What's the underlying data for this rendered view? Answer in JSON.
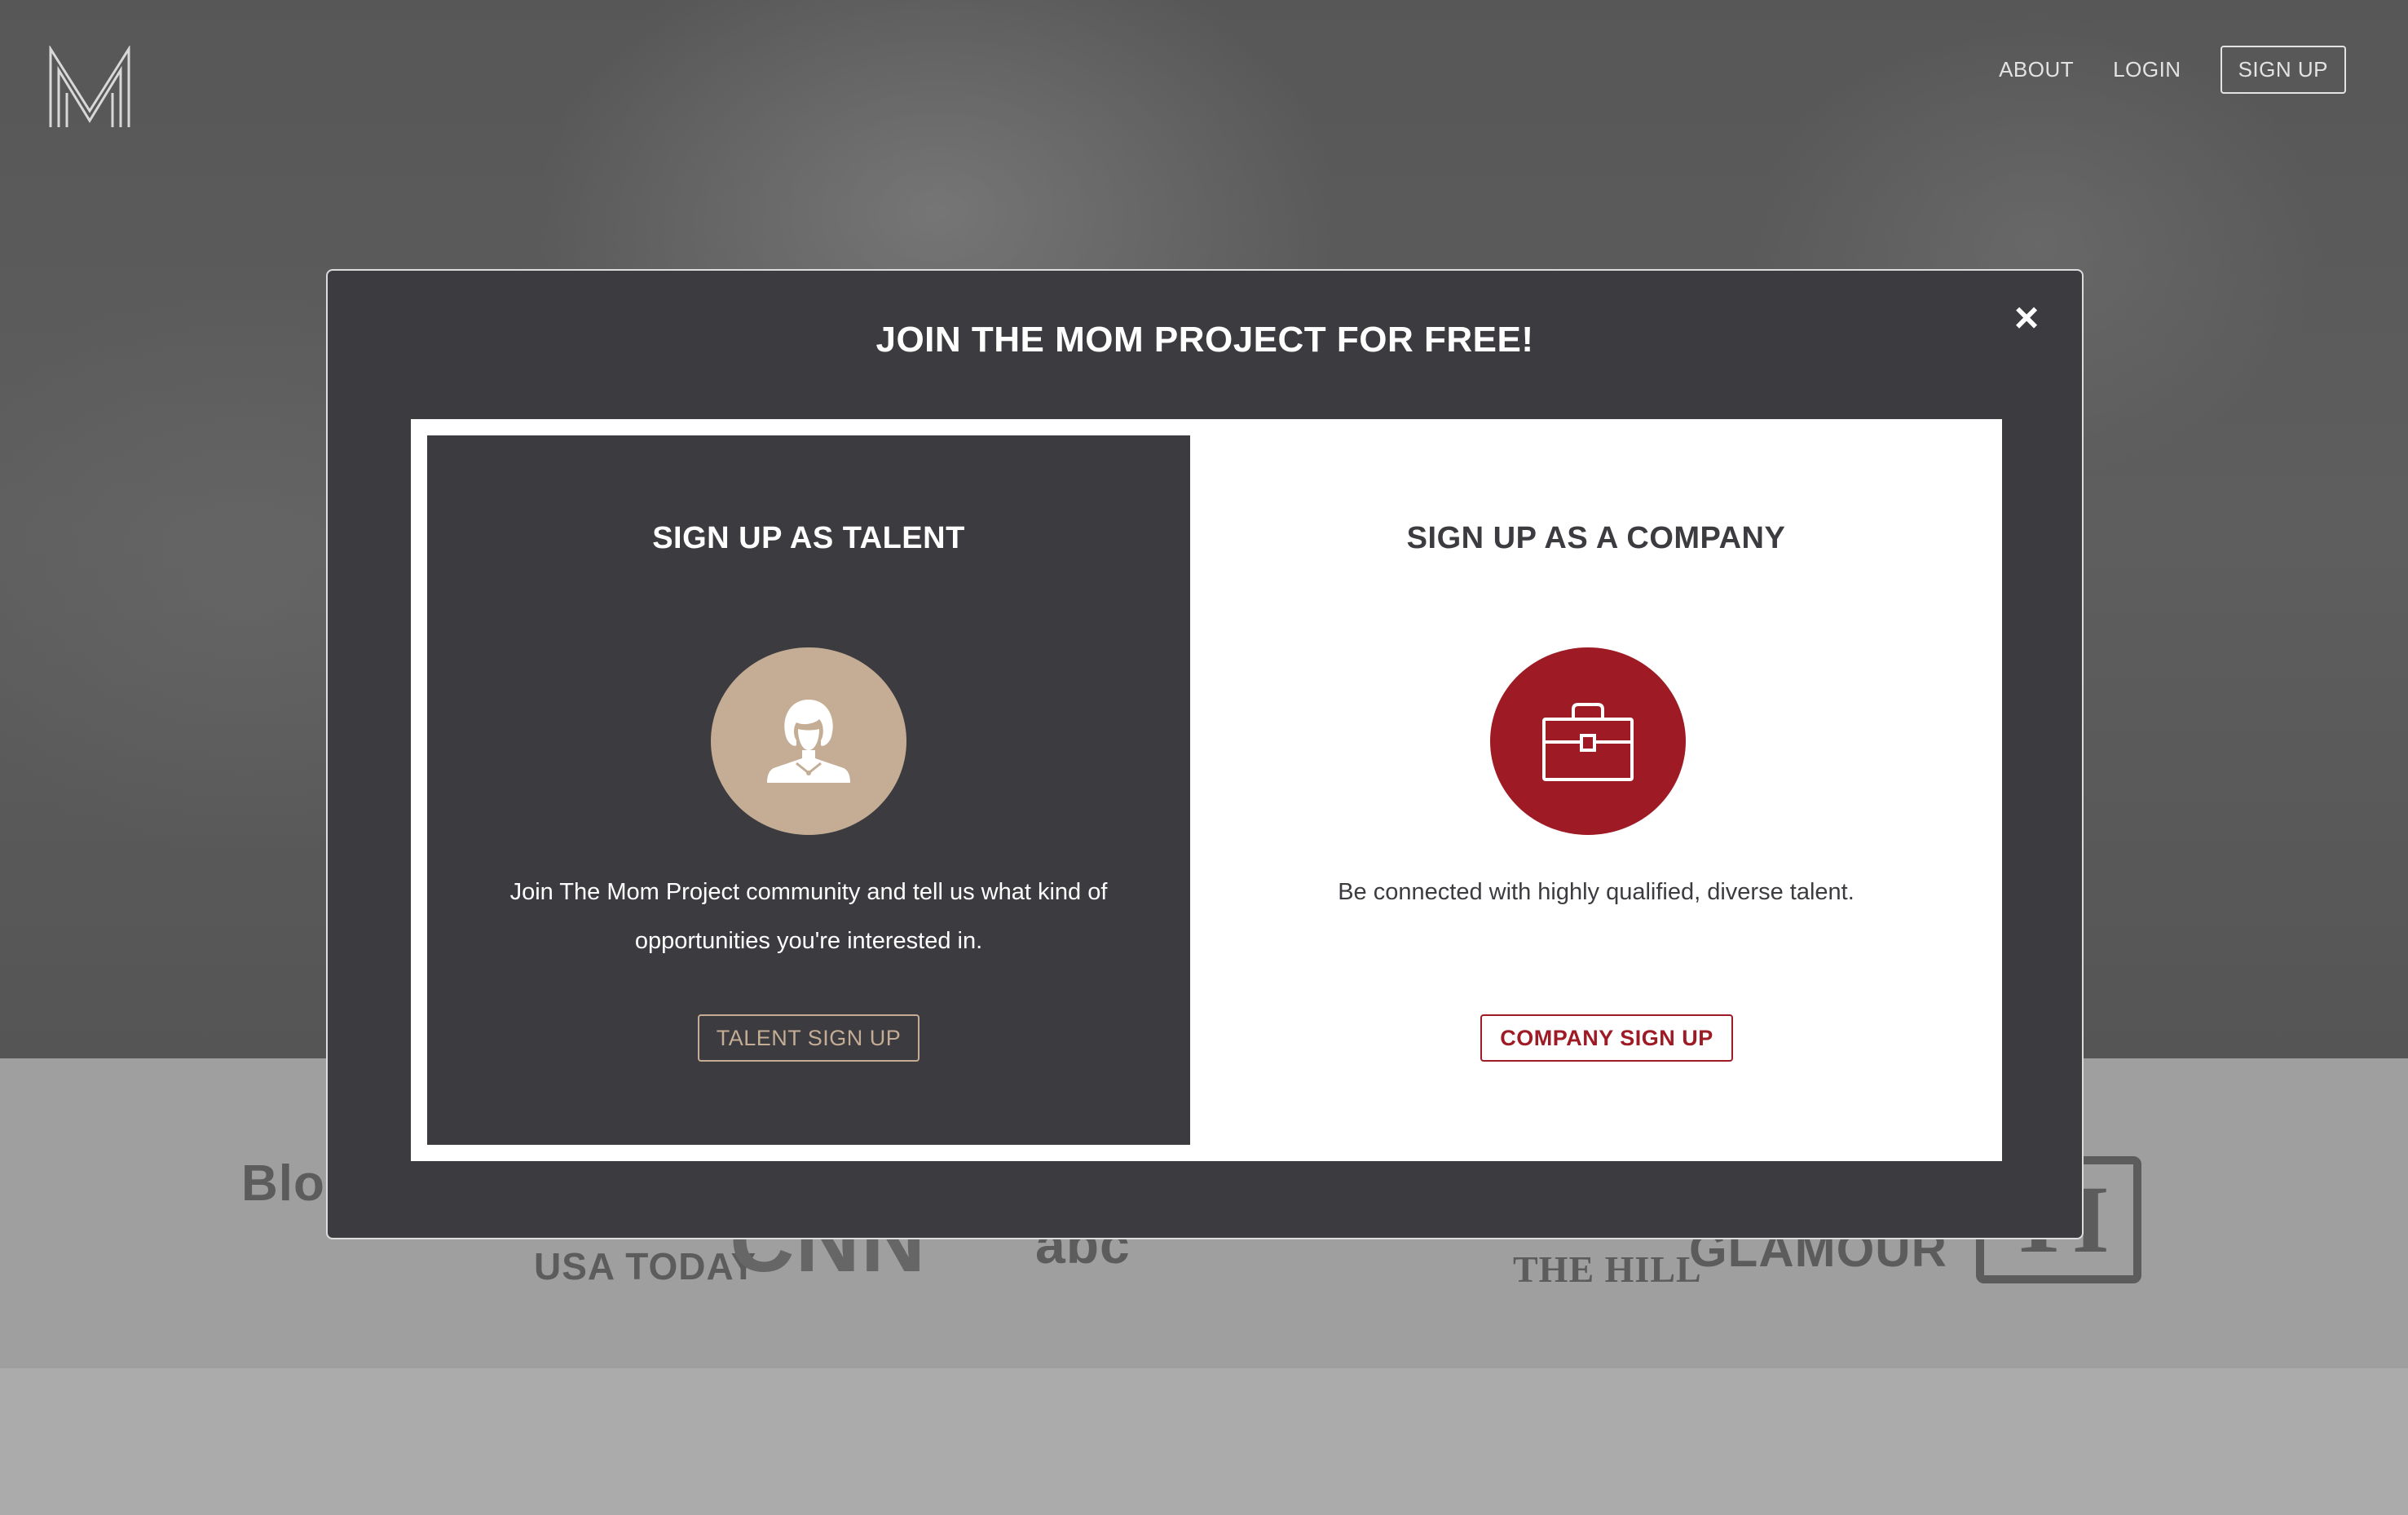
{
  "header": {
    "logo_letter": "M",
    "nav": {
      "about": "ABOUT",
      "login": "LOGIN",
      "signup": "SIGN UP"
    }
  },
  "press_logos": [
    "Bloomberg",
    "USA TODAY",
    "CNN",
    "abc",
    "THE HILL",
    "GLAMOUR",
    "TI"
  ],
  "modal": {
    "title": "JOIN THE MOM PROJECT FOR FREE!",
    "close": "×",
    "talent": {
      "title": "SIGN UP AS TALENT",
      "icon": "woman-avatar-icon",
      "description": "Join The Mom Project community and tell us what kind of opportunities you're interested in.",
      "button": "TALENT SIGN UP"
    },
    "company": {
      "title": "SIGN UP AS A COMPANY",
      "icon": "briefcase-icon",
      "description": "Be connected with highly qualified, diverse talent.",
      "button": "COMPANY SIGN UP"
    }
  },
  "colors": {
    "modal_bg": "#3c3b40",
    "talent_accent": "#c4ad94",
    "company_accent": "#9e1b25"
  }
}
